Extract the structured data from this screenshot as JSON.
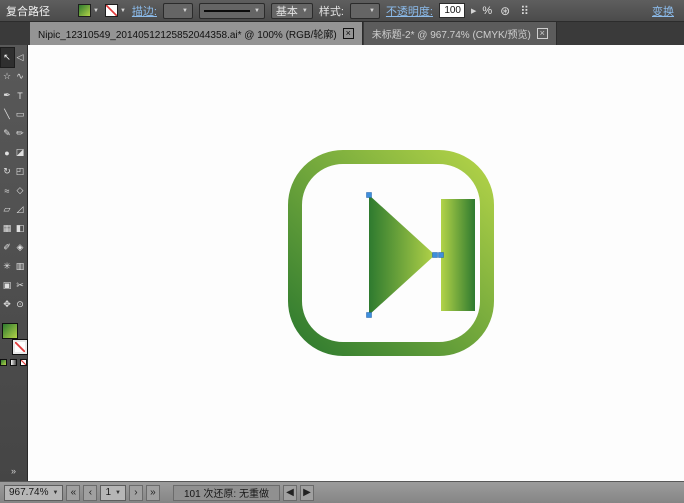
{
  "colors": {
    "green-dark": "#2e7a2f",
    "green-mid": "#6aa93c",
    "green-light": "#b3d348",
    "anchor-blue": "#3e8fdc",
    "link-blue": "#8cbcec",
    "none-red": "#e03a3a"
  },
  "control_bar": {
    "context_label": "复合路径",
    "stroke_link": "描边:",
    "brush_value": "基本",
    "style_label": "样式:",
    "opacity_link": "不透明度:",
    "opacity_value": "100",
    "percent": "%",
    "transform_link": "变换"
  },
  "icons": {
    "chevron_down": "▼",
    "spinner": "▶",
    "close": "×",
    "recolor": "⊛",
    "grid": "⠿",
    "nav_first": "«",
    "nav_prev": "‹",
    "nav_next": "›",
    "nav_last": "»",
    "arrow_left": "◀",
    "arrow_right": "▶",
    "expand": "»"
  },
  "tabs": [
    {
      "label": "Nipic_12310549_20140512125852044358.ai* @ 100% (RGB/轮廓)",
      "close_icon": "×"
    },
    {
      "label": "未标题-2* @ 967.74% (CMYK/预览)",
      "close_icon": "×"
    }
  ],
  "toolbar": {
    "tools": [
      {
        "name": "selection-tool",
        "glyph": "↖",
        "selected": true
      },
      {
        "name": "direct-selection-tool",
        "glyph": "◁"
      },
      {
        "name": "magic-wand-tool",
        "glyph": "☆"
      },
      {
        "name": "lasso-tool",
        "glyph": "∿"
      },
      {
        "name": "pen-tool",
        "glyph": "✒"
      },
      {
        "name": "type-tool",
        "glyph": "T"
      },
      {
        "name": "line-segment-tool",
        "glyph": "╲"
      },
      {
        "name": "rectangle-tool",
        "glyph": "▭"
      },
      {
        "name": "paintbrush-tool",
        "glyph": "✎"
      },
      {
        "name": "pencil-tool",
        "glyph": "✏"
      },
      {
        "name": "blob-brush-tool",
        "glyph": "●"
      },
      {
        "name": "eraser-tool",
        "glyph": "◪"
      },
      {
        "name": "rotate-tool",
        "glyph": "↻"
      },
      {
        "name": "scale-tool",
        "glyph": "◰"
      },
      {
        "name": "width-tool",
        "glyph": "≈"
      },
      {
        "name": "free-transform-tool",
        "glyph": "◇"
      },
      {
        "name": "shape-builder-tool",
        "glyph": "▱"
      },
      {
        "name": "perspective-grid-tool",
        "glyph": "◿"
      },
      {
        "name": "mesh-tool",
        "glyph": "▦"
      },
      {
        "name": "gradient-tool",
        "glyph": "◧"
      },
      {
        "name": "eyedropper-tool",
        "glyph": "✐"
      },
      {
        "name": "blend-tool",
        "glyph": "◈"
      },
      {
        "name": "symbol-sprayer-tool",
        "glyph": "✳"
      },
      {
        "name": "graph-tool",
        "glyph": "▥"
      },
      {
        "name": "artboard-tool",
        "glyph": "▣"
      },
      {
        "name": "slice-tool",
        "glyph": "✂"
      },
      {
        "name": "hand-tool",
        "glyph": "✥"
      },
      {
        "name": "zoom-tool",
        "glyph": "⊙"
      }
    ]
  },
  "statusbar": {
    "zoom_value": "967.74%",
    "page_value": "1",
    "status_text": "101 次还原: 无重做"
  },
  "artwork": {
    "shape": "play-next-icon",
    "border_gradient": [
      "#2e7a2f",
      "#b3d348"
    ],
    "triangle_gradient": [
      "#2e7a2f",
      "#b3d348"
    ],
    "bar_gradient": [
      "#b3d348",
      "#2e7a2f"
    ]
  }
}
